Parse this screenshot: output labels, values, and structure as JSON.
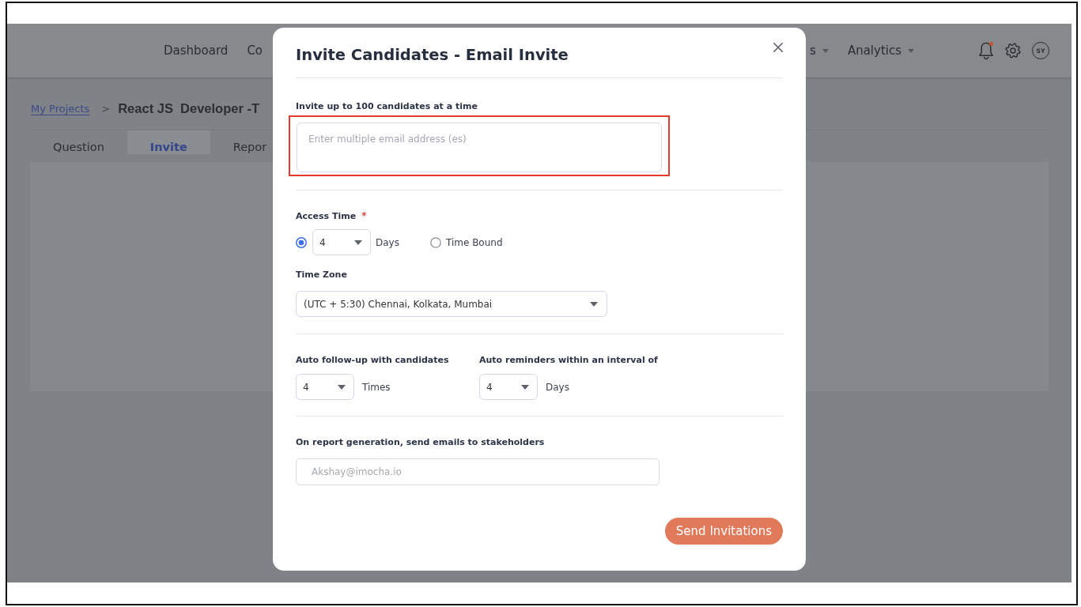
{
  "nav": {
    "items": [
      {
        "label": "Dashboard",
        "dropdown": false
      },
      {
        "label": "Co",
        "dropdown": false
      },
      {
        "label": "s",
        "dropdown": true
      },
      {
        "label": "Analytics",
        "dropdown": true
      }
    ],
    "notifications_unread": true,
    "avatar_initials": "SY"
  },
  "breadcrumb": {
    "link": "My Projects",
    "separator": ">",
    "current": "React JS  Developer -T"
  },
  "tabs": [
    {
      "label": "Question",
      "selected": false
    },
    {
      "label": "Invite",
      "selected": true
    },
    {
      "label": "Repor",
      "selected": false
    }
  ],
  "modal": {
    "title": "Invite Candidates - Email Invite",
    "emails": {
      "label": "Invite up to 100 candidates at a time",
      "placeholder": "Enter multiple email address (es)",
      "highlighted": true
    },
    "access_time": {
      "label": "Access Time",
      "required_mark": "*",
      "options": [
        {
          "kind": "days",
          "selected": true,
          "value": "4",
          "unit": "Days"
        },
        {
          "kind": "time_bound",
          "selected": false,
          "label": "Time Bound"
        }
      ]
    },
    "time_zone": {
      "label": "Time Zone",
      "value": "(UTC + 5:30) Chennai, Kolkata, Mumbai"
    },
    "follow_up": [
      {
        "label": "Auto follow-up with candidates",
        "value": "4",
        "unit": "Times"
      },
      {
        "label": "Auto reminders within an interval of",
        "value": "4",
        "unit": "Days"
      }
    ],
    "stakeholders": {
      "label": "On report generation, send emails to stakeholders",
      "placeholder": "Akshay@imocha.io"
    },
    "submit": "Send Invitations"
  }
}
